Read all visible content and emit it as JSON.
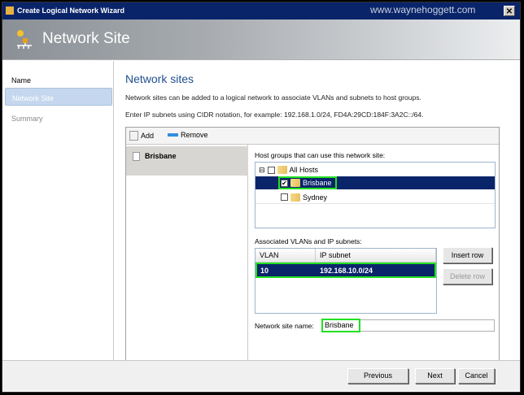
{
  "window": {
    "title": "Create Logical Network Wizard",
    "watermark": "www.waynehoggett.com",
    "close": "✕"
  },
  "banner": {
    "title": "Network Site"
  },
  "nav": [
    {
      "label": "Name"
    },
    {
      "label": "Network Site"
    },
    {
      "label": "Summary"
    }
  ],
  "main": {
    "heading": "Network sites",
    "desc1": "Network sites can be added to a logical network to associate VLANs and subnets to host groups.",
    "desc2": "Enter IP subnets using CIDR notation, for example: 192.168.1.0/24, FD4A:29CD:184F:3A2C::/64.",
    "toolbar": {
      "add": "Add",
      "remove": "Remove"
    },
    "sites": [
      {
        "name": "Brisbane"
      }
    ],
    "host_groups_label": "Host groups that can use this network site:",
    "tree": [
      {
        "label": "All Hosts",
        "checked": false,
        "expander": "⊟"
      },
      {
        "label": "Brisbane",
        "checked": true,
        "check": "✔"
      },
      {
        "label": "Sydney",
        "checked": false
      }
    ],
    "vlan_label": "Associated VLANs and IP subnets:",
    "grid": {
      "headers": [
        "VLAN",
        "IP subnet"
      ],
      "rows": [
        {
          "vlan": "10",
          "subnet": "192.168.10.0/24"
        }
      ]
    },
    "insert_row": "Insert row",
    "delete_row": "Delete row",
    "site_name_label": "Network site name:",
    "site_name_value": "Brisbane"
  },
  "footer": {
    "previous": "Previous",
    "next": "Next",
    "cancel": "Cancel"
  }
}
